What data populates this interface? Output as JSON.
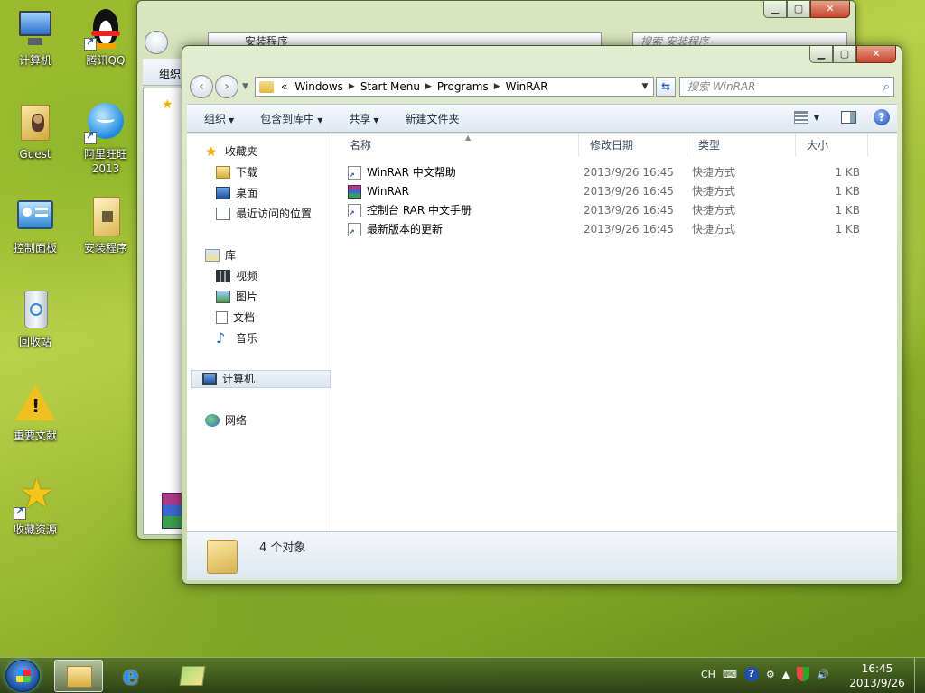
{
  "desktop": {
    "icons": [
      {
        "label": "计算机"
      },
      {
        "label": "腾讯QQ"
      },
      {
        "label": "Guest"
      },
      {
        "label": "阿里旺旺\n2013"
      },
      {
        "label": "控制面板"
      },
      {
        "label": "安装程序"
      },
      {
        "label": "回收站"
      },
      {
        "label": "重要文献"
      },
      {
        "label": "收藏资源"
      }
    ]
  },
  "bg_window": {
    "address": "安装程序",
    "search_placeholder": "搜索 安装程序",
    "toolbar_first": "组织"
  },
  "window": {
    "caption": {
      "minimize": "▁",
      "maximize": "▢",
      "close": "✕"
    },
    "nav": {
      "back": "‹",
      "forward": "›"
    },
    "address": {
      "overflow": "«",
      "crumbs": [
        "Windows",
        "Start Menu",
        "Programs",
        "WinRAR"
      ]
    },
    "search": {
      "placeholder": "搜索 WinRAR"
    },
    "toolbar": {
      "organize": "组织",
      "include_in_library": "包含到库中",
      "share": "共享",
      "new_folder": "新建文件夹"
    },
    "navpane": {
      "favorites": "收藏夹",
      "downloads": "下载",
      "desktop": "桌面",
      "recent": "最近访问的位置",
      "libraries": "库",
      "videos": "视频",
      "pictures": "图片",
      "documents": "文档",
      "music": "音乐",
      "computer": "计算机",
      "network": "网络"
    },
    "columns": {
      "name": "名称",
      "modified": "修改日期",
      "type": "类型",
      "size": "大小"
    },
    "files": [
      {
        "name": "WinRAR 中文帮助",
        "modified": "2013/9/26 16:45",
        "type": "快捷方式",
        "size": "1 KB",
        "icon": "help-shortcut-icon"
      },
      {
        "name": "WinRAR",
        "modified": "2013/9/26 16:45",
        "type": "快捷方式",
        "size": "1 KB",
        "icon": "winrar-icon"
      },
      {
        "name": "控制台 RAR 中文手册",
        "modified": "2013/9/26 16:45",
        "type": "快捷方式",
        "size": "1 KB",
        "icon": "document-shortcut-icon"
      },
      {
        "name": "最新版本的更新",
        "modified": "2013/9/26 16:45",
        "type": "快捷方式",
        "size": "1 KB",
        "icon": "document-shortcut-icon"
      }
    ],
    "status": {
      "count": "4 个对象"
    }
  },
  "taskbar": {
    "language": "CH",
    "clock_time": "16:45",
    "clock_date": "2013/9/26"
  }
}
